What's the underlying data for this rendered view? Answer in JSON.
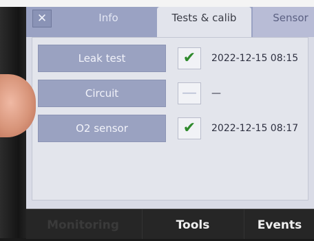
{
  "tabs": {
    "close_symbol": "✕",
    "items": [
      {
        "label": "Info"
      },
      {
        "label": "Tests & calib"
      },
      {
        "label": "Sensor"
      }
    ],
    "active": "Tests & calib"
  },
  "tests": [
    {
      "label": "Leak test",
      "status": "ok",
      "status_symbol": "✔",
      "value": "2022-12-15  08:15"
    },
    {
      "label": "Circuit",
      "status": "not-done",
      "status_symbol": "—",
      "value": "—"
    },
    {
      "label": "O2 sensor",
      "status": "ok",
      "status_symbol": "✔",
      "value": "2022-12-15  08:17"
    }
  ],
  "footer": {
    "items": [
      {
        "label": "Monitoring"
      },
      {
        "label": "Tools"
      },
      {
        "label": "Events"
      }
    ]
  },
  "colors": {
    "check": "#2f8a2c",
    "tab_bar": "#9aa2c3",
    "row_button": "#9aa2c1",
    "active_tab": "#e2e4ec"
  }
}
